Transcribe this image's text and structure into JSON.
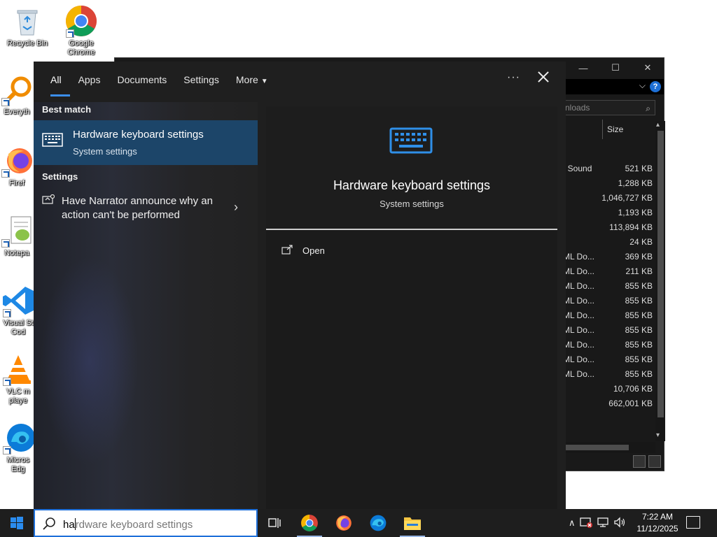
{
  "desktop": {
    "icons": [
      {
        "label": "Recycle Bin"
      },
      {
        "label": "Google Chrome"
      },
      {
        "label": "Everyth"
      },
      {
        "label": "Firef"
      },
      {
        "label": "Notepa"
      },
      {
        "label": "Visual St Cod"
      },
      {
        "label": "VLC m playe"
      },
      {
        "label": "Micros Edg"
      }
    ]
  },
  "explorer": {
    "search_placeholder": "nloads",
    "column_size": "Size",
    "rows": [
      {
        "type": "t Sound",
        "size": "521 KB"
      },
      {
        "type": "",
        "size": "1,288 KB"
      },
      {
        "type": "",
        "size": "1,046,727 KB"
      },
      {
        "type": "",
        "size": "1,193 KB"
      },
      {
        "type": "",
        "size": "113,894 KB"
      },
      {
        "type": "",
        "size": "24 KB"
      },
      {
        "type": "ML Do...",
        "size": "369 KB"
      },
      {
        "type": "ML Do...",
        "size": "211 KB"
      },
      {
        "type": "ML Do...",
        "size": "855 KB"
      },
      {
        "type": "ML Do...",
        "size": "855 KB"
      },
      {
        "type": "ML Do...",
        "size": "855 KB"
      },
      {
        "type": "ML Do...",
        "size": "855 KB"
      },
      {
        "type": "ML Do...",
        "size": "855 KB"
      },
      {
        "type": "ML Do...",
        "size": "855 KB"
      },
      {
        "type": "ML Do...",
        "size": "855 KB"
      },
      {
        "type": "",
        "size": "10,706 KB"
      },
      {
        "type": "",
        "size": "662,001 KB"
      }
    ]
  },
  "search_panel": {
    "tabs": [
      {
        "label": "All",
        "active": true
      },
      {
        "label": "Apps"
      },
      {
        "label": "Documents"
      },
      {
        "label": "Settings"
      },
      {
        "label": "More"
      }
    ],
    "best_match_heading": "Best match",
    "best_match": {
      "title": "Hardware keyboard settings",
      "subtitle": "System settings"
    },
    "settings_heading": "Settings",
    "settings_item": {
      "text": "Have Narrator announce why an action can't be performed"
    },
    "preview": {
      "title": "Hardware keyboard settings",
      "subtitle": "System settings",
      "action_open": "Open"
    },
    "accent_color": "#1c4569"
  },
  "taskbar": {
    "search_typed": "ha",
    "search_rest": "rdware keyboard settings",
    "clock_time": "7:22 AM",
    "clock_date": "11/12/2025"
  }
}
